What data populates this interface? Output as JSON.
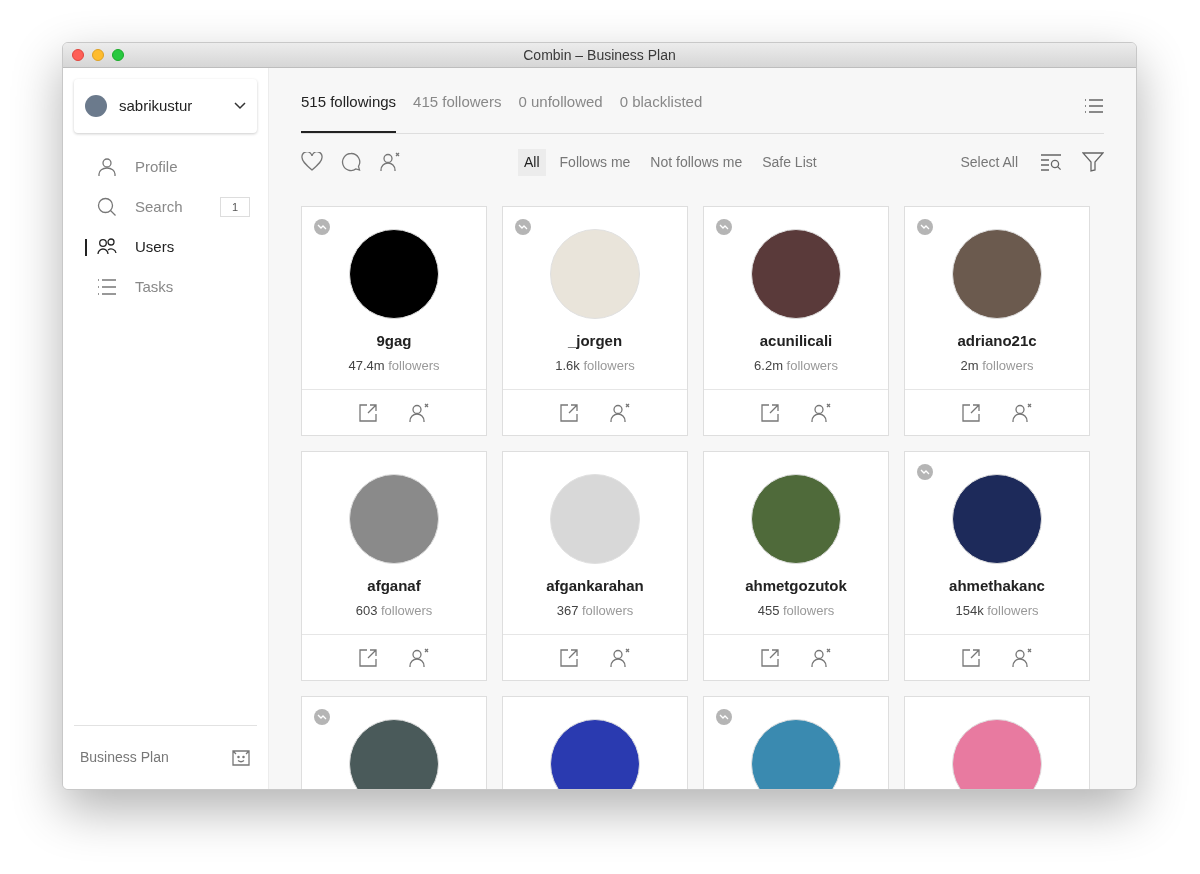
{
  "window": {
    "title": "Combin – Business Plan"
  },
  "account": {
    "username": "sabrikustur"
  },
  "nav": [
    {
      "label": "Profile",
      "kind": "person",
      "selected": false
    },
    {
      "label": "Search",
      "kind": "search",
      "selected": false,
      "count": "1"
    },
    {
      "label": "Users",
      "kind": "users",
      "selected": true
    },
    {
      "label": "Tasks",
      "kind": "list",
      "selected": false
    }
  ],
  "plan": {
    "label": "Business Plan"
  },
  "tabs": [
    {
      "label": "515 followings",
      "selected": true
    },
    {
      "label": "415 followers",
      "selected": false
    },
    {
      "label": "0 unfollowed",
      "selected": false
    },
    {
      "label": "0 blacklisted",
      "selected": false
    }
  ],
  "filters": [
    {
      "label": "All",
      "selected": true
    },
    {
      "label": "Follows me",
      "selected": false
    },
    {
      "label": "Not follows me",
      "selected": false
    },
    {
      "label": "Safe List",
      "selected": false
    }
  ],
  "select_all": "Select All",
  "users": [
    {
      "name": "9gag",
      "count": "47.4m",
      "unit": "followers",
      "badge": true,
      "color": "#000000"
    },
    {
      "name": "_jorgen",
      "count": "1.6k",
      "unit": "followers",
      "badge": true,
      "color": "#e9e4da"
    },
    {
      "name": "acunilicali",
      "count": "6.2m",
      "unit": "followers",
      "badge": true,
      "color": "#5a3a3a"
    },
    {
      "name": "adriano21c",
      "count": "2m",
      "unit": "followers",
      "badge": true,
      "color": "#6b5a4e"
    },
    {
      "name": "afganaf",
      "count": "603",
      "unit": "followers",
      "badge": false,
      "color": "#8a8a8a"
    },
    {
      "name": "afgankarahan",
      "count": "367",
      "unit": "followers",
      "badge": false,
      "color": "#d8d8d8"
    },
    {
      "name": "ahmetgozutok",
      "count": "455",
      "unit": "followers",
      "badge": false,
      "color": "#4f6a3a"
    },
    {
      "name": "ahmethakanc",
      "count": "154k",
      "unit": "followers",
      "badge": true,
      "color": "#1d2a5a"
    },
    {
      "badge": true,
      "color": "#4a5a5a"
    },
    {
      "badge": false,
      "color": "#2a3ab0"
    },
    {
      "badge": true,
      "color": "#3a8ab0"
    },
    {
      "badge": false,
      "color": "#e87aa0"
    }
  ]
}
